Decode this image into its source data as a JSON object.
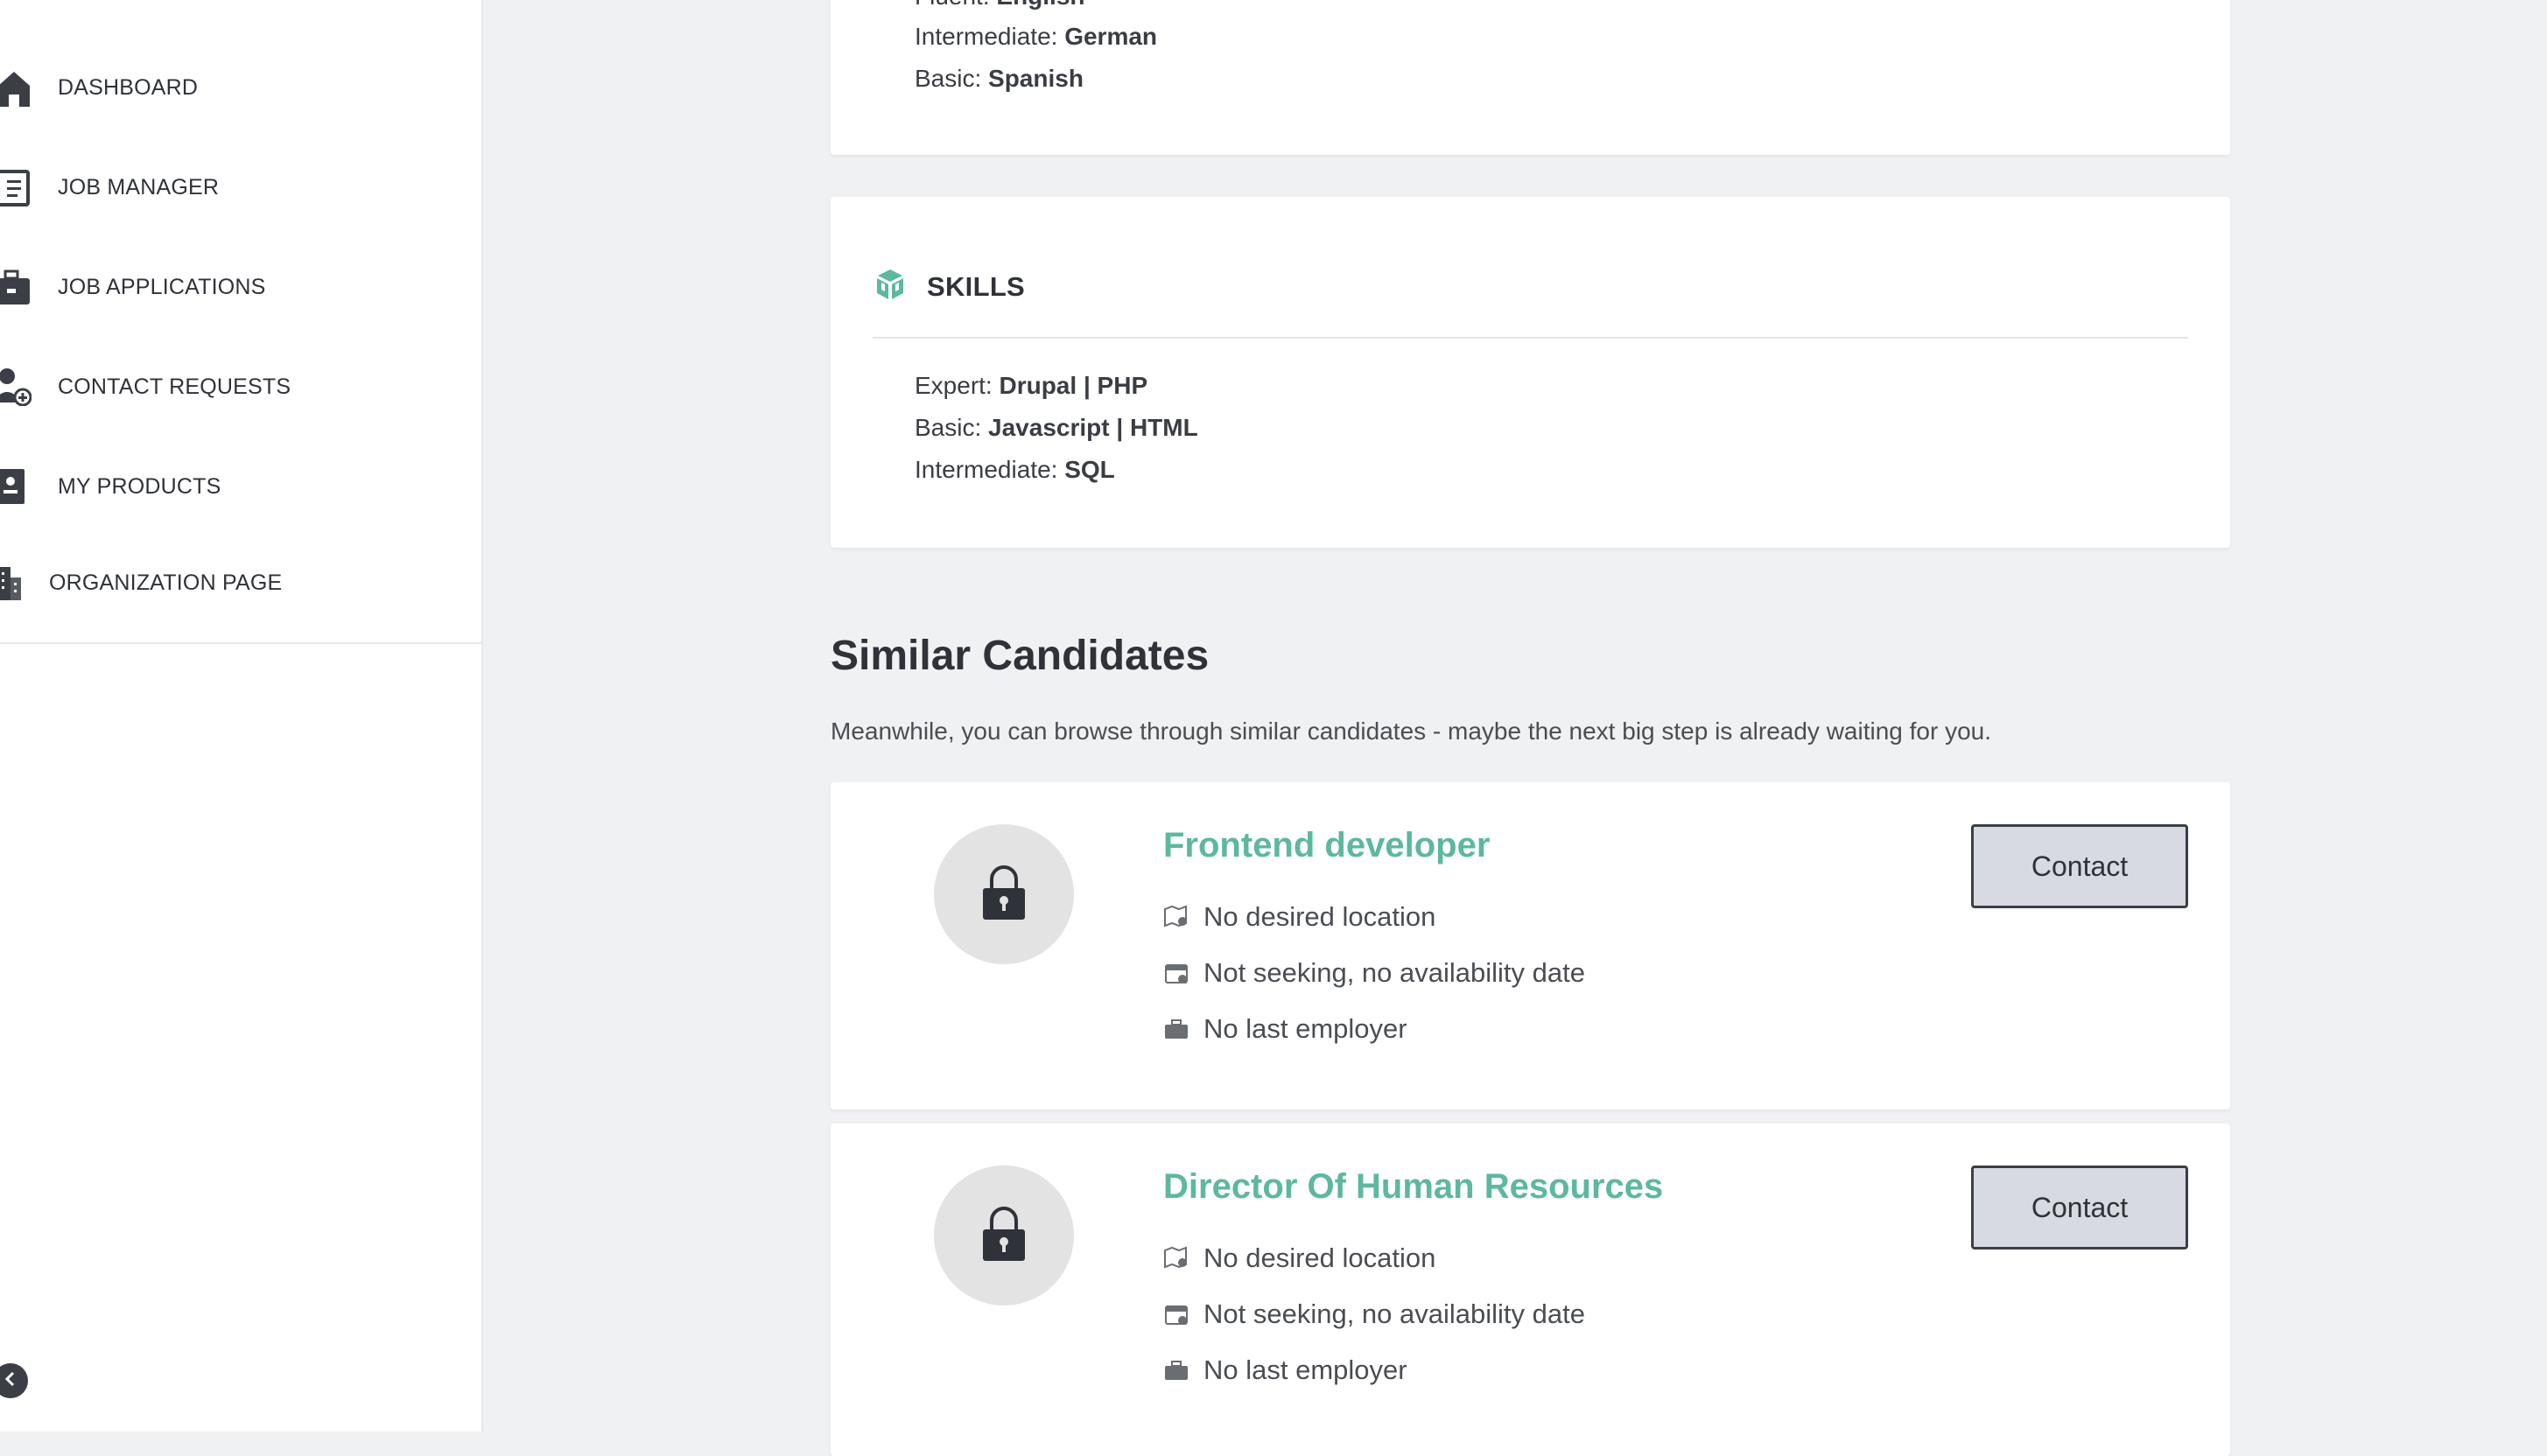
{
  "sidebar": {
    "items": [
      {
        "label": "DASHBOARD",
        "icon": "home-icon"
      },
      {
        "label": "JOB MANAGER",
        "icon": "job-manager-icon"
      },
      {
        "label": "JOB APPLICATIONS",
        "icon": "briefcase-icon"
      },
      {
        "label": "CONTACT REQUESTS",
        "icon": "user-add-icon"
      },
      {
        "label": "MY PRODUCTS",
        "icon": "products-icon"
      },
      {
        "label": "ORGANIZATION PAGE",
        "icon": "building-icon"
      }
    ],
    "collapse_icon": "chevron-left-icon"
  },
  "languages": {
    "lines": [
      {
        "level": "Fluent:",
        "value": "English"
      },
      {
        "level": "Intermediate:",
        "value": "German"
      },
      {
        "level": "Basic:",
        "value": "Spanish"
      }
    ]
  },
  "skills": {
    "title": "SKILLS",
    "icon": "skills-cube-icon",
    "lines": [
      {
        "level": "Expert:",
        "value": "Drupal | PHP"
      },
      {
        "level": "Basic:",
        "value": "Javascript | HTML"
      },
      {
        "level": "Intermediate:",
        "value": "SQL"
      }
    ]
  },
  "similar": {
    "title": "Similar Candidates",
    "description": "Meanwhile, you can browse through similar candidates - maybe the next big step is already waiting for you.",
    "contact_label": "Contact",
    "candidates": [
      {
        "title": "Frontend developer",
        "location": "No desired location",
        "availability": "Not seeking, no availability date",
        "employer": "No last employer"
      },
      {
        "title": "Director Of Human Resources",
        "location": "No desired location",
        "availability": "Not seeking, no availability date",
        "employer": "No last employer"
      }
    ]
  },
  "colors": {
    "accent": "#5cb89f",
    "text": "#3a3d42",
    "background": "#f0f1f3"
  }
}
